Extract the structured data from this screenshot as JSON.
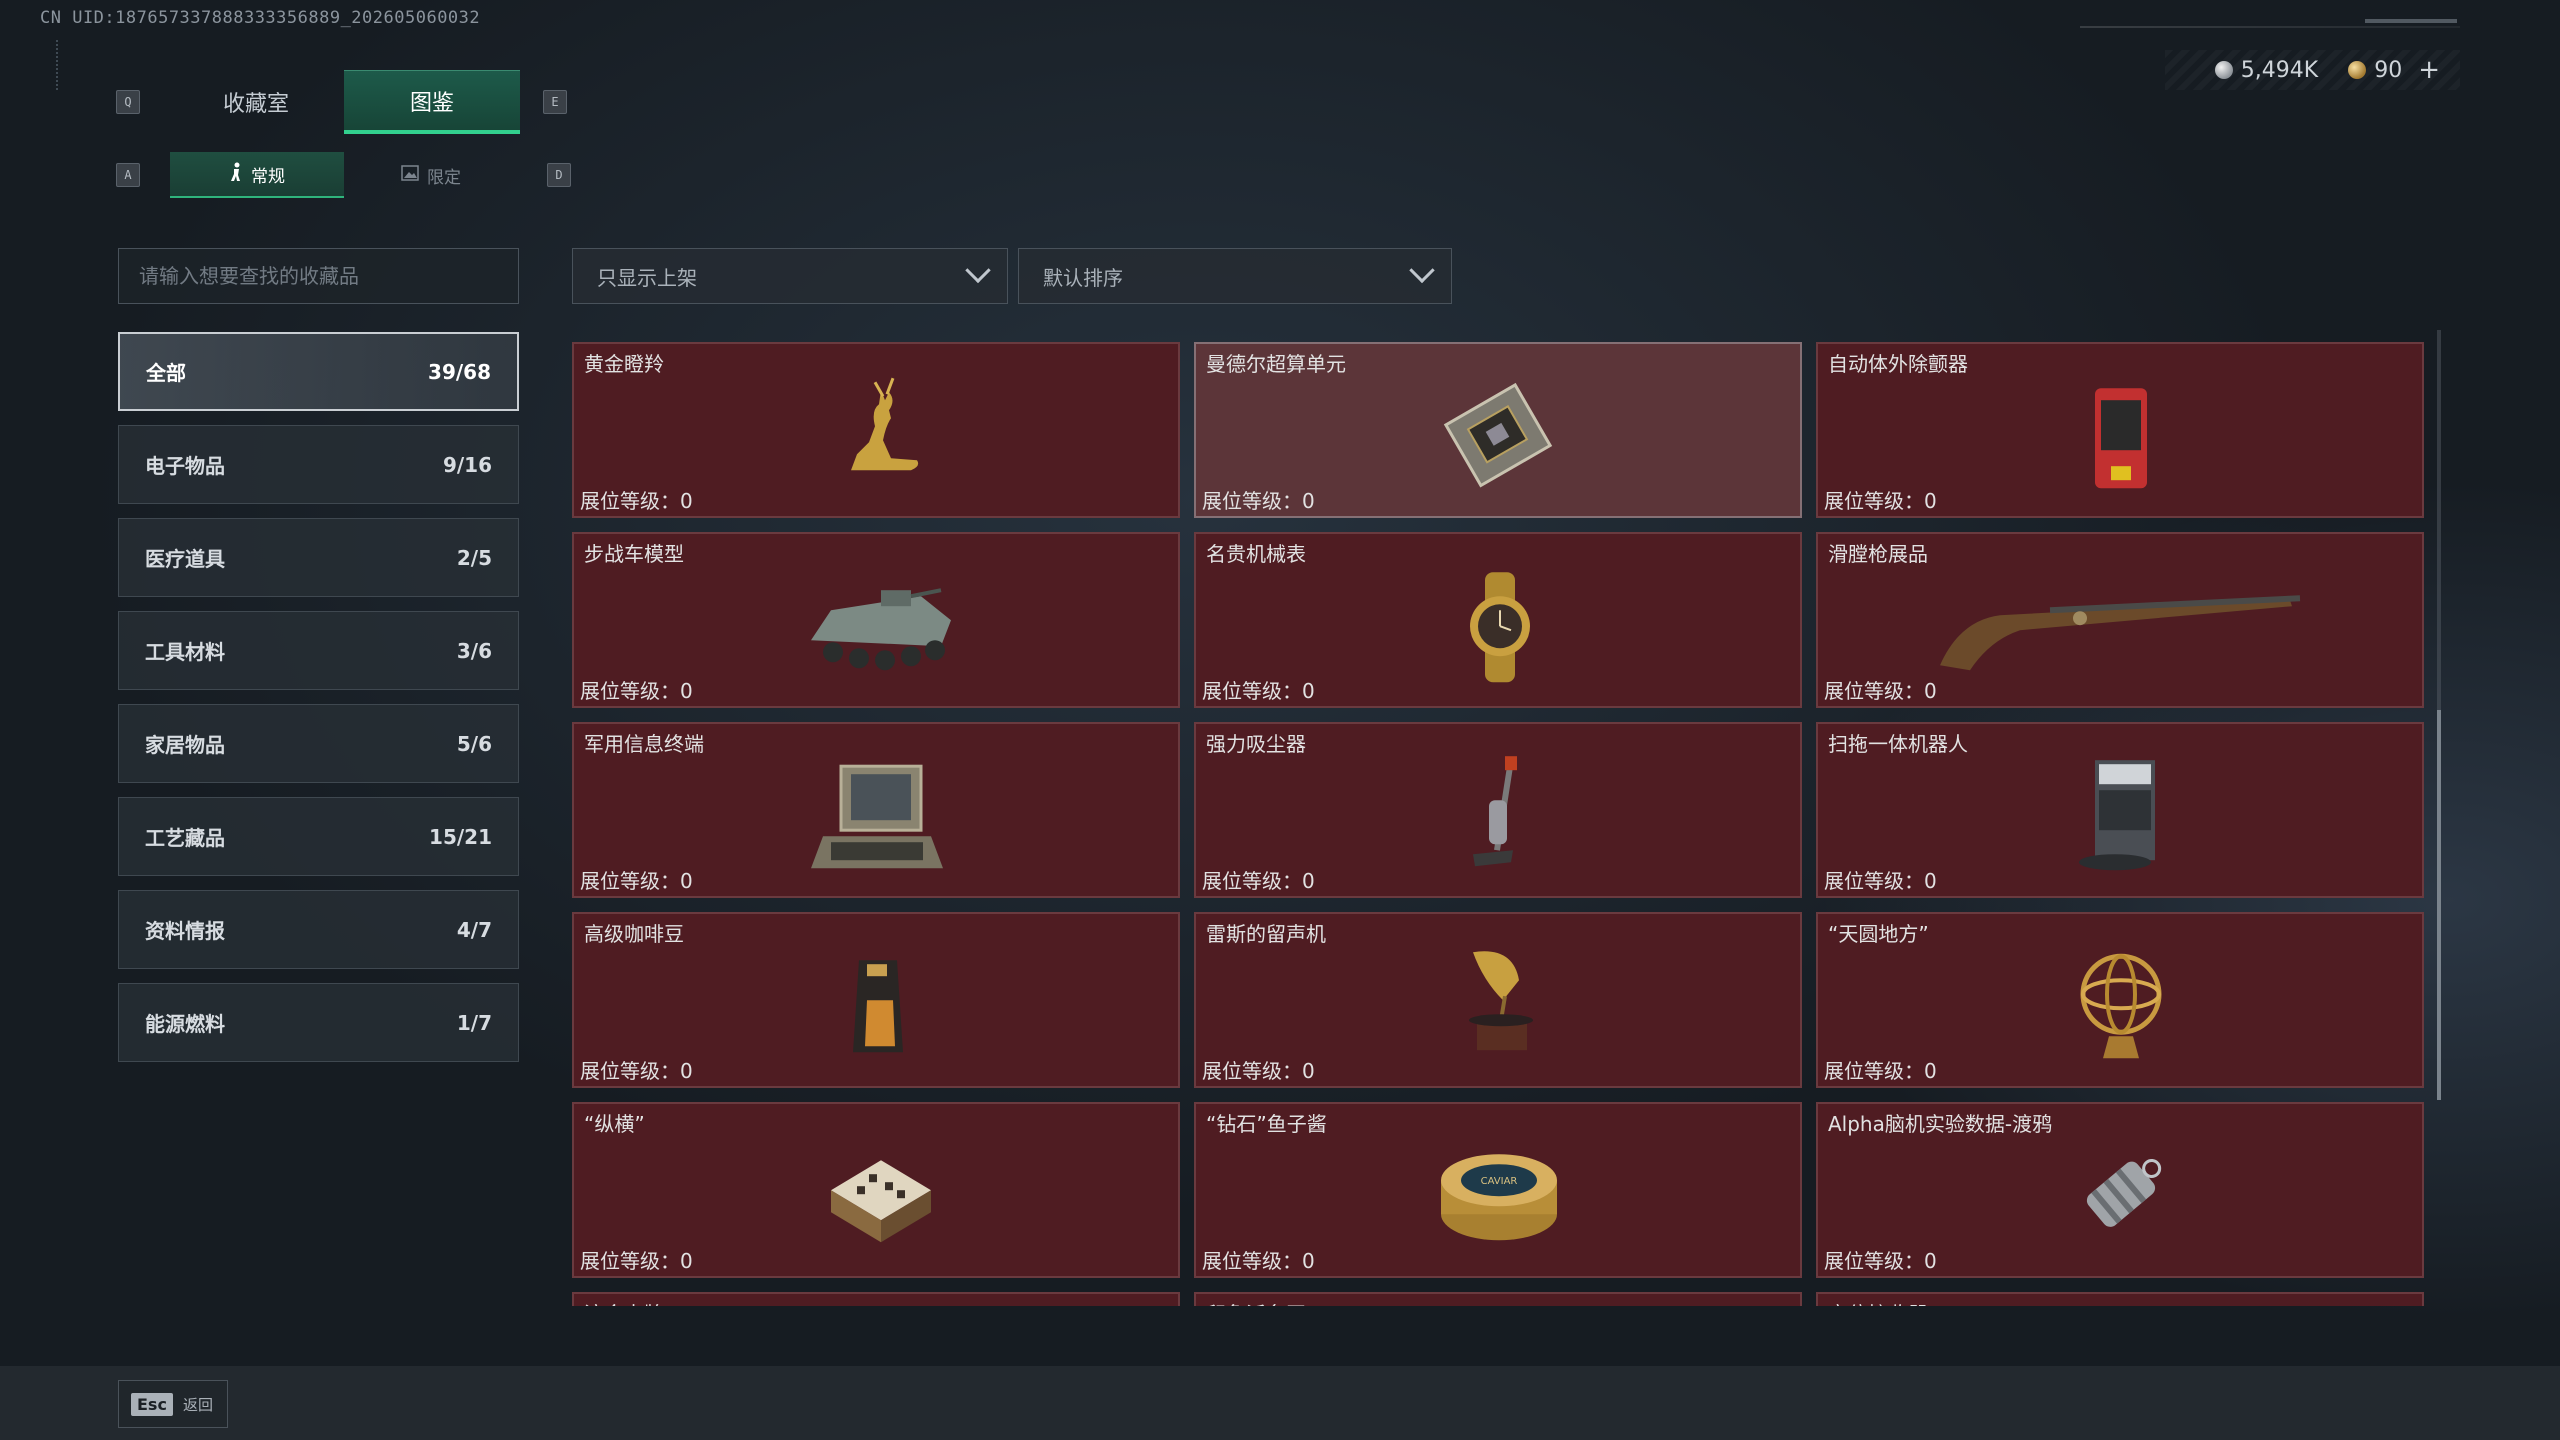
{
  "uid": "CN UID:187657337888333356889_202605060032",
  "currency": {
    "silver": "5,494K",
    "gold": "90",
    "plus": "+"
  },
  "keys": {
    "q": "Q",
    "e": "E",
    "a": "A",
    "d": "D"
  },
  "tabs_main": [
    {
      "label": "收藏室"
    },
    {
      "label": "图鉴"
    }
  ],
  "tabs_sub": [
    {
      "label": "常规",
      "icon": "figure-icon"
    },
    {
      "label": "限定",
      "icon": "picture-icon"
    }
  ],
  "search": {
    "placeholder": "请输入想要查找的收藏品"
  },
  "filters": {
    "shelf": "只显示上架",
    "sort": "默认排序"
  },
  "categories": [
    {
      "label": "全部",
      "count": "39/68"
    },
    {
      "label": "电子物品",
      "count": "9/16"
    },
    {
      "label": "医疗道具",
      "count": "2/5"
    },
    {
      "label": "工具材料",
      "count": "3/6"
    },
    {
      "label": "家居物品",
      "count": "5/6"
    },
    {
      "label": "工艺藏品",
      "count": "15/21"
    },
    {
      "label": "资料情报",
      "count": "4/7"
    },
    {
      "label": "能源燃料",
      "count": "1/7"
    }
  ],
  "level_text": "展位等级：0",
  "items": [
    {
      "name": "黄金瞪羚",
      "icon": "gold-gazelle-icon"
    },
    {
      "name": "曼德尔超算单元",
      "icon": "supercomputer-unit-icon"
    },
    {
      "name": "自动体外除颤器",
      "icon": "defibrillator-icon"
    },
    {
      "name": "步战车模型",
      "icon": "ifv-model-icon"
    },
    {
      "name": "名贵机械表",
      "icon": "watch-icon"
    },
    {
      "name": "滑膛枪展品",
      "icon": "musket-icon"
    },
    {
      "name": "军用信息终端",
      "icon": "military-terminal-icon"
    },
    {
      "name": "强力吸尘器",
      "icon": "vacuum-icon"
    },
    {
      "name": "扫拖一体机器人",
      "icon": "robot-vacuum-icon"
    },
    {
      "name": "高级咖啡豆",
      "icon": "coffee-beans-icon"
    },
    {
      "name": "雷斯的留声机",
      "icon": "gramophone-icon"
    },
    {
      "name": "“天圆地方”",
      "icon": "armillary-sphere-icon"
    },
    {
      "name": "“纵横”",
      "icon": "chess-box-icon"
    },
    {
      "name": "“钻石”鱼子酱",
      "icon": "caviar-icon"
    },
    {
      "name": "Alpha脑机实验数据-渡鸦",
      "icon": "data-capsule-icon"
    },
    {
      "name": "滚金卡牌",
      "icon": "card-icon"
    },
    {
      "name": "印象派名画",
      "icon": "painting-icon"
    },
    {
      "name": "定位接收器",
      "icon": "receiver-icon"
    }
  ],
  "caviar_label": "CAVIAR",
  "bottom": {
    "esc_key": "Esc",
    "esc_label": "返回"
  },
  "colors": {
    "accent": "#32d08e",
    "card_bg": "#4f1c22",
    "card_highlight": "#5c3539"
  }
}
